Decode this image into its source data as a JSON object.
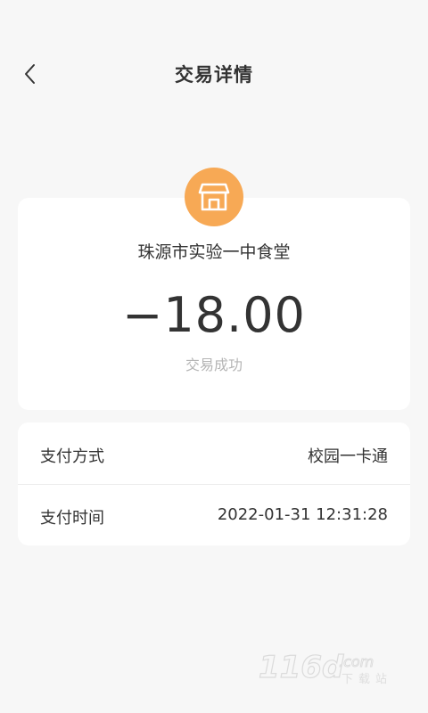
{
  "header": {
    "title": "交易详情",
    "back_icon": "chevron-left-icon"
  },
  "summary": {
    "merchant_icon": "storefront-icon",
    "merchant_name": "珠源市实验一中食堂",
    "amount": "−18.00",
    "status": "交易成功"
  },
  "details": [
    {
      "label": "支付方式",
      "value": "校园一卡通"
    },
    {
      "label": "支付时间",
      "value": "2022-01-31  12:31:28"
    }
  ],
  "watermark": {
    "logo_text": "116d.com",
    "sub_text": "下载站"
  },
  "colors": {
    "background": "#f7f7f7",
    "card": "#ffffff",
    "accent": "#f7a955",
    "muted_text": "#b5b5b5"
  }
}
